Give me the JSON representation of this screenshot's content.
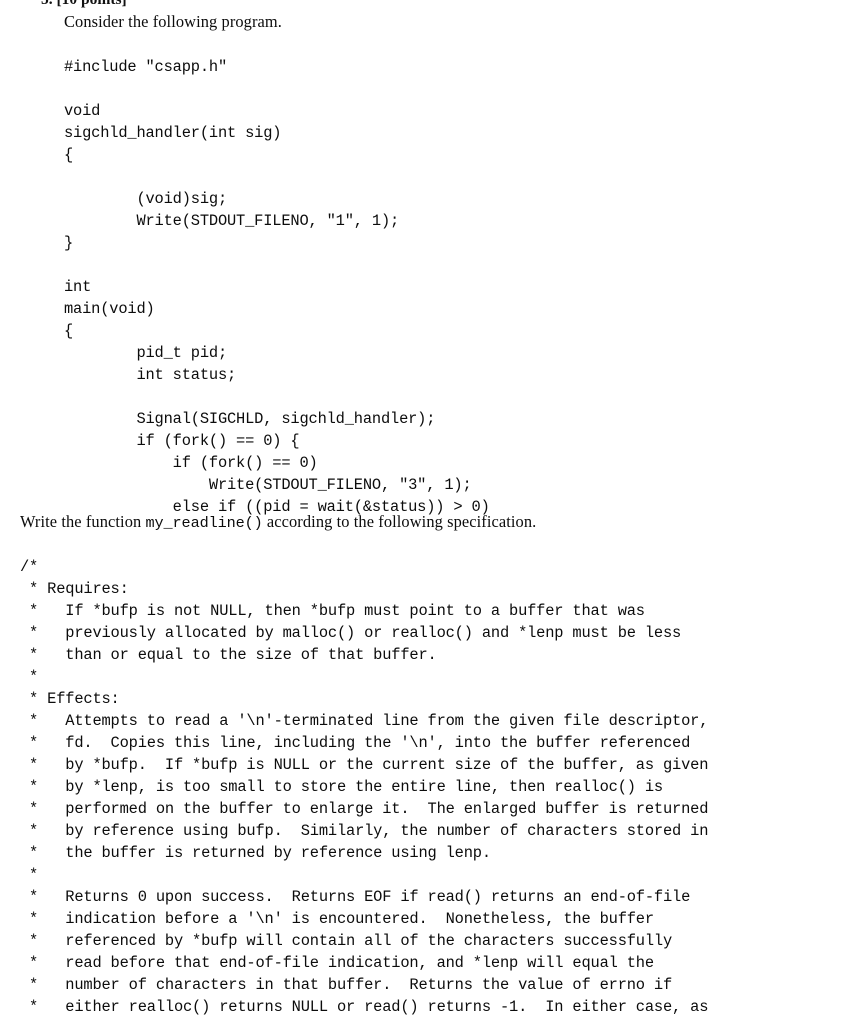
{
  "document": {
    "type": "exam-question-scan",
    "background_color": "#ffffff",
    "text_color": "#0c0c0c"
  },
  "header": {
    "clipped_line": "5. [10 points]"
  },
  "question_one": {
    "intro_line": "Consider the following program.",
    "code_lines": [
      "#include \"csapp.h\"",
      "",
      "void",
      "sigchld_handler(int sig)",
      "{",
      "",
      "        (void)sig;",
      "        Write(STDOUT_FILENO, \"1\", 1);",
      "}",
      "",
      "int",
      "main(void)",
      "{",
      "        pid_t pid;",
      "        int status;",
      "",
      "        Signal(SIGCHLD, sigchld_handler);",
      "        if (fork() == 0) {",
      "            if (fork() == 0)",
      "                Write(STDOUT_FILENO, \"3\", 1);",
      "            else if ((pid = wait(&status)) > 0)"
    ]
  },
  "question_two": {
    "instruction_prefix": "Write the function ",
    "instruction_mono": "my_readline()",
    "instruction_suffix": " according to the following specification.",
    "spec_comment_lines": [
      "/*",
      " * Requires:",
      " *   If *bufp is not NULL, then *bufp must point to a buffer that was",
      " *   previously allocated by malloc() or realloc() and *lenp must be less",
      " *   than or equal to the size of that buffer.",
      " *",
      " * Effects:",
      " *   Attempts to read a '\\n'-terminated line from the given file descriptor,",
      " *   fd.  Copies this line, including the '\\n', into the buffer referenced",
      " *   by *bufp.  If *bufp is NULL or the current size of the buffer, as given",
      " *   by *lenp, is too small to store the entire line, then realloc() is",
      " *   performed on the buffer to enlarge it.  The enlarged buffer is returned",
      " *   by reference using bufp.  Similarly, the number of characters stored in",
      " *   the buffer is returned by reference using lenp.",
      " *",
      " *   Returns 0 upon success.  Returns EOF if read() returns an end-of-file",
      " *   indication before a '\\n' is encountered.  Nonetheless, the buffer",
      " *   referenced by *bufp will contain all of the characters successfully",
      " *   read before that end-of-file indication, and *lenp will equal the",
      " *   number of characters in that buffer.  Returns the value of errno if",
      " *   either realloc() returns NULL or read() returns -1.  In either case, as"
    ]
  }
}
